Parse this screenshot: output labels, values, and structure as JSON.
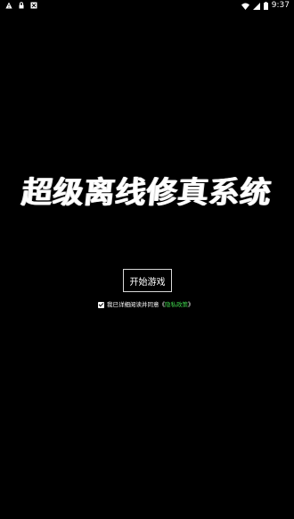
{
  "status_bar": {
    "time": "9:37",
    "icons": [
      "warning-icon",
      "lock-icon",
      "image-icon",
      "wifi-icon",
      "signal-icon",
      "battery-icon"
    ]
  },
  "game": {
    "title": "超级离线修真系统",
    "start_button": "开始游戏",
    "agreement": {
      "checked": true,
      "text": "我已详细阅读并同意",
      "bracket_open": "《",
      "privacy_link": "隐私政策",
      "bracket_close": "》"
    }
  },
  "colors": {
    "background": "#000000",
    "text": "#ffffff",
    "link": "#3fd44c",
    "status_warning": "#ff3b30"
  }
}
